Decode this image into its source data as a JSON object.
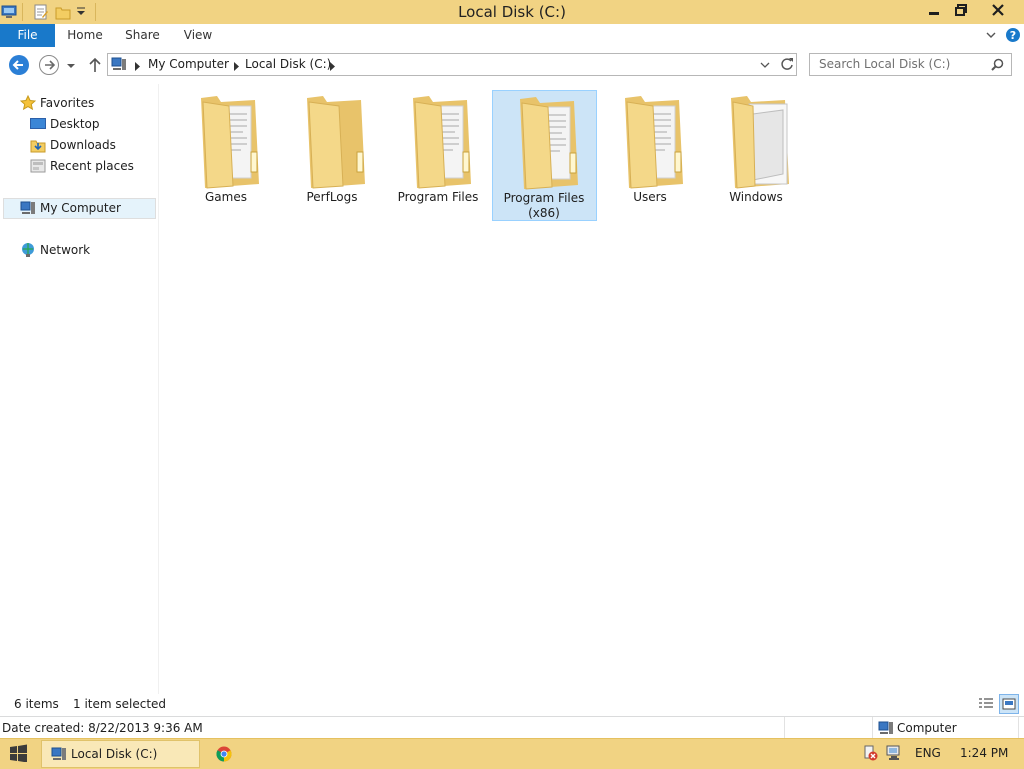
{
  "window": {
    "title": "Local Disk (C:)",
    "quick_access": [
      "computer-icon",
      "properties-icon",
      "new-folder-icon",
      "customize-dropdown-icon"
    ],
    "controls": [
      "minimize-icon",
      "restore-icon",
      "close-icon"
    ]
  },
  "ribbon": {
    "tabs": [
      "File",
      "Home",
      "Share",
      "View"
    ]
  },
  "address": {
    "breadcrumb": [
      "My Computer",
      "Local Disk (C:)"
    ],
    "search_placeholder": "Search Local Disk (C:)"
  },
  "nav": {
    "favorites": "Favorites",
    "desktop": "Desktop",
    "downloads": "Downloads",
    "recent": "Recent places",
    "computer": "My Computer",
    "network": "Network"
  },
  "folders": [
    {
      "name": "Games",
      "selected": false
    },
    {
      "name": "PerfLogs",
      "selected": false
    },
    {
      "name": "Program Files",
      "selected": false
    },
    {
      "name": "Program Files (x86)",
      "selected": true
    },
    {
      "name": "Users",
      "selected": false
    },
    {
      "name": "Windows",
      "selected": false
    }
  ],
  "status": {
    "item_count": "6 items",
    "selected": "1 item selected",
    "date_created": "Date created: 8/22/2013 9:36 AM",
    "location": "Computer"
  },
  "taskbar": {
    "window_button": "Local Disk (C:)",
    "language": "ENG",
    "time": "1:24 PM"
  },
  "colors": {
    "titlebar": "#f1d383",
    "file_tab": "#1979ca",
    "selection": "#cce4f7",
    "folder": "#f1d27f"
  }
}
